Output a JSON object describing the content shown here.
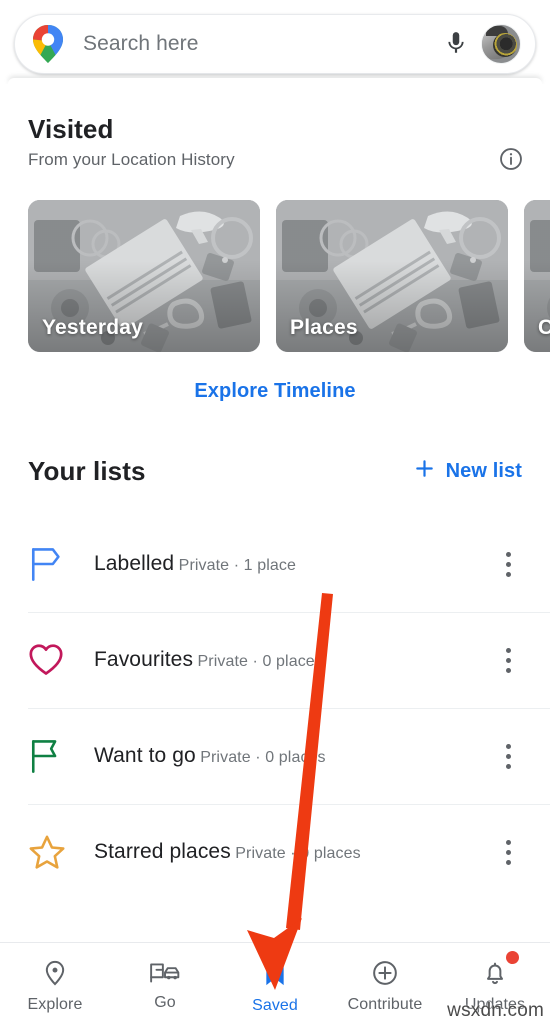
{
  "search": {
    "placeholder": "Search here",
    "logo_icon": "google-maps-pin-icon",
    "mic_icon": "microphone-icon",
    "avatar_icon": "profile-avatar"
  },
  "visited": {
    "title": "Visited",
    "subtitle": "From your Location History",
    "info_icon": "info-icon",
    "cards": [
      {
        "caption": "Yesterday"
      },
      {
        "caption": "Places"
      },
      {
        "caption": "C"
      }
    ],
    "explore_timeline_label": "Explore Timeline"
  },
  "your_lists": {
    "title": "Your lists",
    "new_list_label": "New list",
    "new_list_icon": "plus-icon",
    "menu_icon": "overflow-menu-icon",
    "items": [
      {
        "name": "Labelled",
        "meta": "Private · 1 place",
        "icon": "flag-icon",
        "color": "#4285f4"
      },
      {
        "name": "Favourites",
        "meta": "Private · 0 places",
        "icon": "heart-icon",
        "color": "#c2185b"
      },
      {
        "name": "Want to go",
        "meta": "Private · 0 places",
        "icon": "flag-icon",
        "color": "#0f8043"
      },
      {
        "name": "Starred places",
        "meta": "Private · 0 places",
        "icon": "star-icon",
        "color": "#e8a33d"
      }
    ]
  },
  "bottom_nav": {
    "active_index": 2,
    "items": [
      {
        "label": "Explore",
        "icon": "map-pin-icon",
        "badge": false
      },
      {
        "label": "Go",
        "icon": "transit-car-icon",
        "badge": false
      },
      {
        "label": "Saved",
        "icon": "bookmark-icon",
        "badge": false
      },
      {
        "label": "Contribute",
        "icon": "plus-circle-icon",
        "badge": false
      },
      {
        "label": "Updates",
        "icon": "bell-icon",
        "badge": true
      }
    ]
  },
  "annotation": {
    "arrow_icon": "red-arrow-annotation",
    "color": "#ee3a12"
  },
  "watermark": {
    "text": "wsxdn.com"
  },
  "colors": {
    "accent_blue": "#1a73e8",
    "text_primary": "#202124",
    "text_secondary": "#5f6368",
    "badge_red": "#ea4335"
  }
}
